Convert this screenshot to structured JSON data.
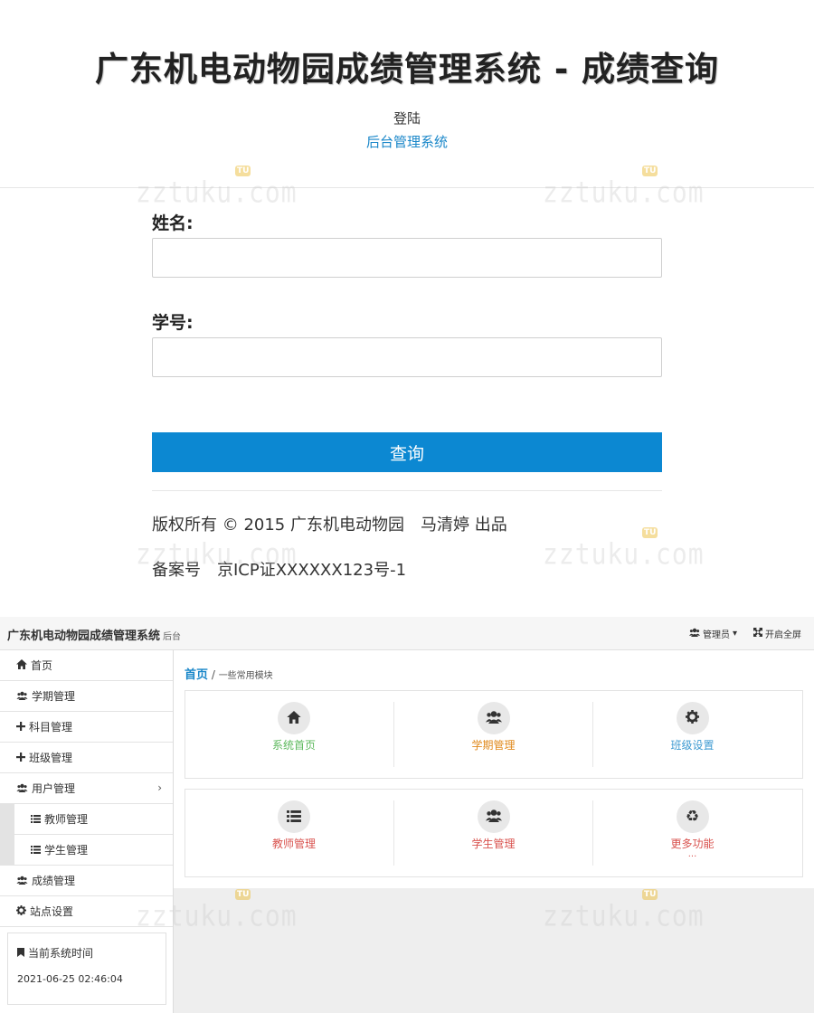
{
  "login": {
    "title": "广东机电动物园成绩管理系统 - 成绩查询",
    "link_login": "登陆",
    "link_admin": "后台管理系统",
    "name_label": "姓名:",
    "name_value": "",
    "id_label": "学号:",
    "id_value": "",
    "query_button": "查询",
    "copyright": "版权所有 © 2015 广东机电动物园　马清婷 出品",
    "icp": "备案号　京ICP证XXXXXX123号-1",
    "button_color": "#0c88d2",
    "link_color": "#1a87c9"
  },
  "admin": {
    "brand": "广东机电动物园成绩管理系统",
    "brand_sub": "后台",
    "topbar": {
      "user_menu": "管理员",
      "user_icon": "users-icon",
      "fullscreen": "开启全屏",
      "fullscreen_icon": "expand-icon"
    },
    "sidebar": {
      "items": [
        {
          "label": "首页",
          "icon": "home-icon"
        },
        {
          "label": "学期管理",
          "icon": "users-icon"
        },
        {
          "label": "科目管理",
          "icon": "plus-icon"
        },
        {
          "label": "班级管理",
          "icon": "plus-icon"
        },
        {
          "label": "用户管理",
          "icon": "users-icon",
          "chevron": "›"
        },
        {
          "label": "教师管理",
          "icon": "list-icon"
        },
        {
          "label": "学生管理",
          "icon": "list-icon"
        },
        {
          "label": "成绩管理",
          "icon": "users-icon"
        },
        {
          "label": "站点设置",
          "icon": "gear-icon"
        }
      ],
      "time_title": "当前系统时间",
      "time_icon": "bookmark-icon",
      "time_value": "2021-06-25 02:46:04"
    },
    "breadcrumb": {
      "home": "首页",
      "separator": " / ",
      "sub": "一些常用模块"
    },
    "tiles": [
      {
        "label": "系统首页",
        "icon": "home-icon",
        "color": "#5cb85c"
      },
      {
        "label": "学期管理",
        "icon": "users-icon",
        "color": "#e08a1e"
      },
      {
        "label": "班级设置",
        "icon": "gear-icon",
        "color": "#3d9ad1"
      },
      {
        "label": "教师管理",
        "icon": "list-icon",
        "color": "#d9534f"
      },
      {
        "label": "学生管理",
        "icon": "users-icon",
        "color": "#d9534f"
      },
      {
        "label": "更多功能",
        "icon": "recycle-icon",
        "color": "#d9534f",
        "extra": "..."
      }
    ]
  },
  "watermark": {
    "text": "zztuku.com",
    "badge": "TU"
  }
}
